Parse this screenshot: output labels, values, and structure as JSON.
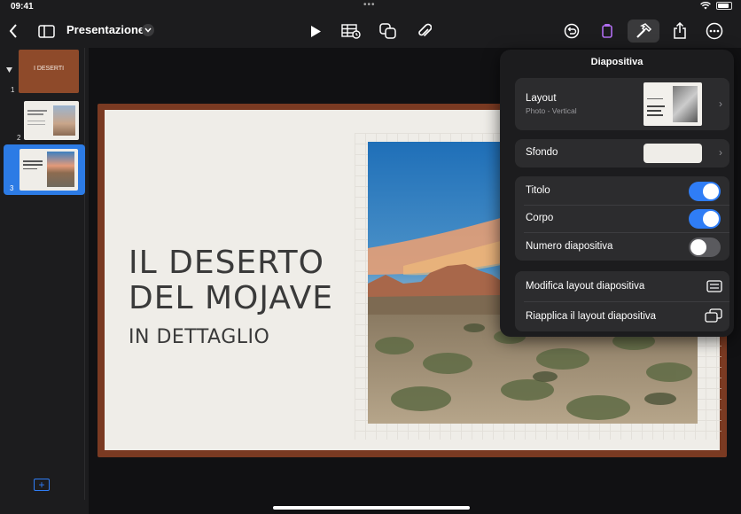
{
  "status_bar": {
    "time": "09:41",
    "dots": "•••"
  },
  "toolbar": {
    "doc_title": "Presentazione",
    "icons": [
      "back-chevron-icon",
      "sidebar-icon",
      "title-chevron-icon",
      "play-icon",
      "table-icon",
      "shapes-icon",
      "attachment-icon",
      "undo-icon",
      "format-brush-icon",
      "hammer-icon",
      "share-icon",
      "more-icon"
    ]
  },
  "navigator": {
    "slides": [
      {
        "number": "1",
        "title": "I DESERTI"
      },
      {
        "number": "2",
        "title": ""
      },
      {
        "number": "3",
        "title": ""
      }
    ],
    "selected": 3
  },
  "slide": {
    "title_line1": "IL DESERTO",
    "title_line2": "DEL MOJAVE",
    "subtitle": "IN DETTAGLIO"
  },
  "popover": {
    "title": "Diapositiva",
    "layout_label": "Layout",
    "layout_value": "Photo - Vertical",
    "background_label": "Sfondo",
    "toggles": [
      {
        "label": "Titolo",
        "on": true
      },
      {
        "label": "Corpo",
        "on": true
      },
      {
        "label": "Numero diapositiva",
        "on": false
      }
    ],
    "actions": [
      {
        "label": "Modifica layout diapositiva"
      },
      {
        "label": "Riapplica il layout diapositiva"
      }
    ]
  },
  "colors": {
    "accent": "#2f7df6",
    "slide_frame": "#7a3a22",
    "slide_bg": "#efede8"
  }
}
